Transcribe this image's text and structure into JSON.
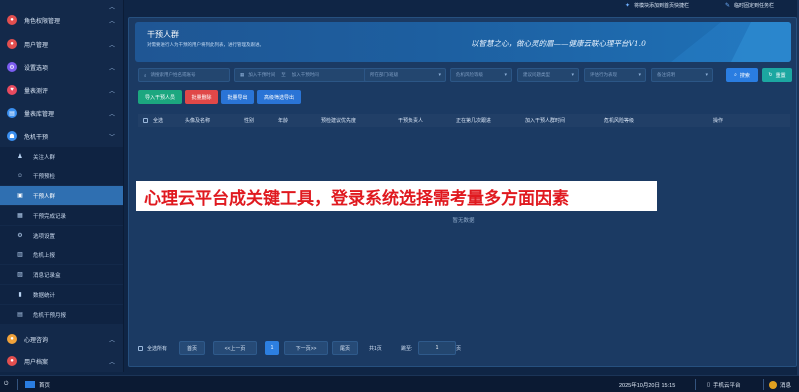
{
  "quick_links": {
    "add_home": "将模块添加到首页快捷栏",
    "pin_task": "临时固定到任务栏"
  },
  "sidebar": {
    "items": [
      {
        "label": "角色权限管理",
        "icon": "role-icon",
        "color": "#e24f4f"
      },
      {
        "label": "用户管理",
        "icon": "user-icon",
        "color": "#e24f4f"
      },
      {
        "label": "设置选项",
        "icon": "settings-icon",
        "color": "#7b5cf0"
      },
      {
        "label": "量表测评",
        "icon": "scale-test-icon",
        "color": "#e84a5f"
      },
      {
        "label": "量表库管理",
        "icon": "scale-library-icon",
        "color": "#3a8ff0"
      },
      {
        "label": "危机干预",
        "icon": "crisis-icon",
        "color": "#3a8ff0"
      }
    ],
    "sub_items": [
      {
        "label": "关注人群",
        "icon": "people-icon"
      },
      {
        "label": "干预预检",
        "icon": "precheck-icon"
      },
      {
        "label": "干预人群",
        "icon": "intervene-icon",
        "active": true
      },
      {
        "label": "干预完成记录",
        "icon": "record-icon"
      },
      {
        "label": "选项设置",
        "icon": "option-gear-icon"
      },
      {
        "label": "危机上报",
        "icon": "report-icon"
      },
      {
        "label": "消息记录盒",
        "icon": "message-box-icon"
      },
      {
        "label": "数据统计",
        "icon": "stats-icon"
      },
      {
        "label": "危机干预月报",
        "icon": "monthly-report-icon"
      }
    ],
    "bottom_items": [
      {
        "label": "心理咨询",
        "icon": "consult-icon",
        "color": "#f0a23a"
      },
      {
        "label": "用户档案",
        "icon": "archive-icon",
        "color": "#e24f4f"
      }
    ]
  },
  "banner": {
    "title": "干预人群",
    "description": "对需要进行人为干预的用户将列此列表，进行管理及跟进。",
    "slogan": "以智慧之心，做心灵的眉——健康云联心理平台V1.0"
  },
  "filters": {
    "name_placeholder": "请搜索用户姓名或账号",
    "start_time": "加入干预时间",
    "separator": "至",
    "end_time": "加入干预时间",
    "dept": "所在部门/班级",
    "risk_level": "危机风险等级",
    "suggest_type": "建议问题类型",
    "method": "评估行为表现",
    "status": "备注说明",
    "search": "搜索",
    "reset": "重置"
  },
  "actions": {
    "import": "导入干预人员",
    "batch_delete": "批量删除",
    "batch_export": "批量导出",
    "advanced_export": "高级筛选导出"
  },
  "table": {
    "headers": [
      "全选",
      "头像及名称",
      "性别",
      "年龄",
      "预检建议优先度",
      "干预负责人",
      "正在第几次跟进",
      "加入干预人群时间",
      "危机风险等级",
      "操作"
    ],
    "empty_text": "暂无数据"
  },
  "overlay_caption": "心理云平台成关键工具，登录系统选择需考量多方面因素",
  "pager": {
    "select_all": "全选所有",
    "first": "首页",
    "prev": "<<上一页",
    "current": "1",
    "next": "下一页>>",
    "last": "尾页",
    "total": "共1页",
    "jump": "跳至:",
    "jump_value": "1",
    "page_unit": "页"
  },
  "taskbar": {
    "home": "首页",
    "datetime": "2025年10月20日 15:15",
    "mobile": "手机云平台",
    "message": "消息"
  },
  "colors": {
    "accent": "#2a7de1",
    "import_btn": "#1ca77f",
    "delete_btn": "#e04848",
    "export_btn": "#2a74d6"
  }
}
